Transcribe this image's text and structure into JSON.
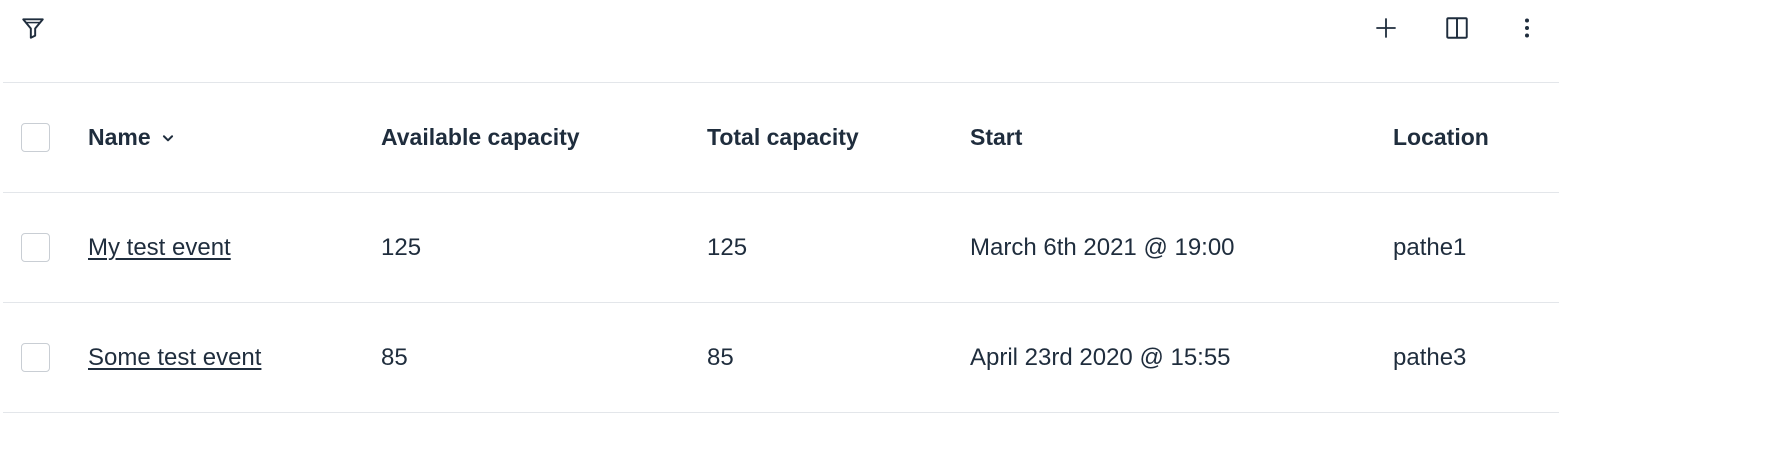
{
  "toolbar": {
    "icons": {
      "filter": "filter-icon",
      "add": "plus-icon",
      "columns": "columns-icon",
      "more": "more-vertical-icon"
    }
  },
  "table": {
    "columns": [
      {
        "key": "name",
        "label": "Name"
      },
      {
        "key": "available_capacity",
        "label": "Available capacity"
      },
      {
        "key": "total_capacity",
        "label": "Total capacity"
      },
      {
        "key": "start",
        "label": "Start"
      },
      {
        "key": "location",
        "label": "Location"
      }
    ],
    "sort": {
      "column": "name",
      "icon": "chevron-down-icon"
    },
    "rows": [
      {
        "name": "My test event",
        "available_capacity": "125",
        "total_capacity": "125",
        "start": "March 6th 2021 @ 19:00",
        "location": "pathe1"
      },
      {
        "name": "Some test event",
        "available_capacity": "85",
        "total_capacity": "85",
        "start": "April 23rd 2020 @ 15:55",
        "location": "pathe3"
      }
    ]
  },
  "colors": {
    "text": "#1f2d3d",
    "divider": "#e3e6ea",
    "checkbox_border": "#c9ced4"
  }
}
